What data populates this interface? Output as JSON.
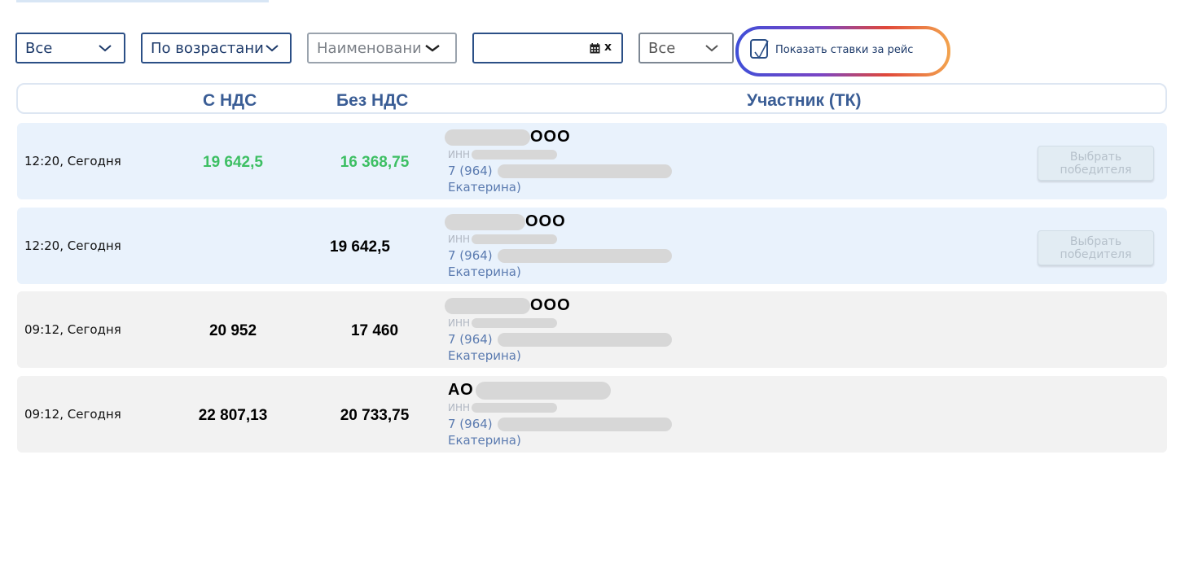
{
  "filters": {
    "status_select": "Все",
    "sort_select": "По возрастани",
    "name_select": "Наименовани",
    "date_input": "",
    "type_select": "Все",
    "show_rates_label": "Показать ставки за рейс",
    "show_rates_checked": true
  },
  "table": {
    "headers": {
      "time": "",
      "with_vat": "С НДС",
      "without_vat": "Без НДС",
      "participant": "Участник (ТК)"
    },
    "rows": [
      {
        "time": "12:20, Сегодня",
        "with_vat": "19 642,5",
        "without_vat": "16 368,75",
        "company_suffix": "ООО",
        "inn_label": "ИНН",
        "phone": "7 (964)",
        "contact": "Екатерина)",
        "action": "Выбрать победителя",
        "highlight": "green"
      },
      {
        "time": "12:20, Сегодня",
        "with_vat": "",
        "without_vat": "19 642,5",
        "company_suffix": "ООО",
        "inn_label": "ИНН",
        "phone": "7 (964)",
        "contact": "Екатерина)",
        "action": "Выбрать победителя"
      },
      {
        "time": "09:12, Сегодня",
        "with_vat": "20 952",
        "without_vat": "17 460",
        "company_suffix": "ООО",
        "inn_label": "ИНН",
        "phone": "7 (964)",
        "contact": "Екатерина)"
      },
      {
        "time": "09:12, Сегодня",
        "with_vat": "22 807,13",
        "without_vat": "20 733,75",
        "company_prefix": "АО",
        "inn_label": "ИНН",
        "phone": "7 (964)",
        "contact": "Екатерина)"
      }
    ]
  },
  "colors": {
    "accent": "#2b4f86",
    "header_text": "#3a5d95",
    "best_price": "#3dbf63",
    "row_blue": "#e9f2fc",
    "row_grey": "#f2f2f2"
  },
  "icons": [
    "chevron-down-icon",
    "calendar-icon",
    "clear-icon",
    "checkmark-icon"
  ]
}
